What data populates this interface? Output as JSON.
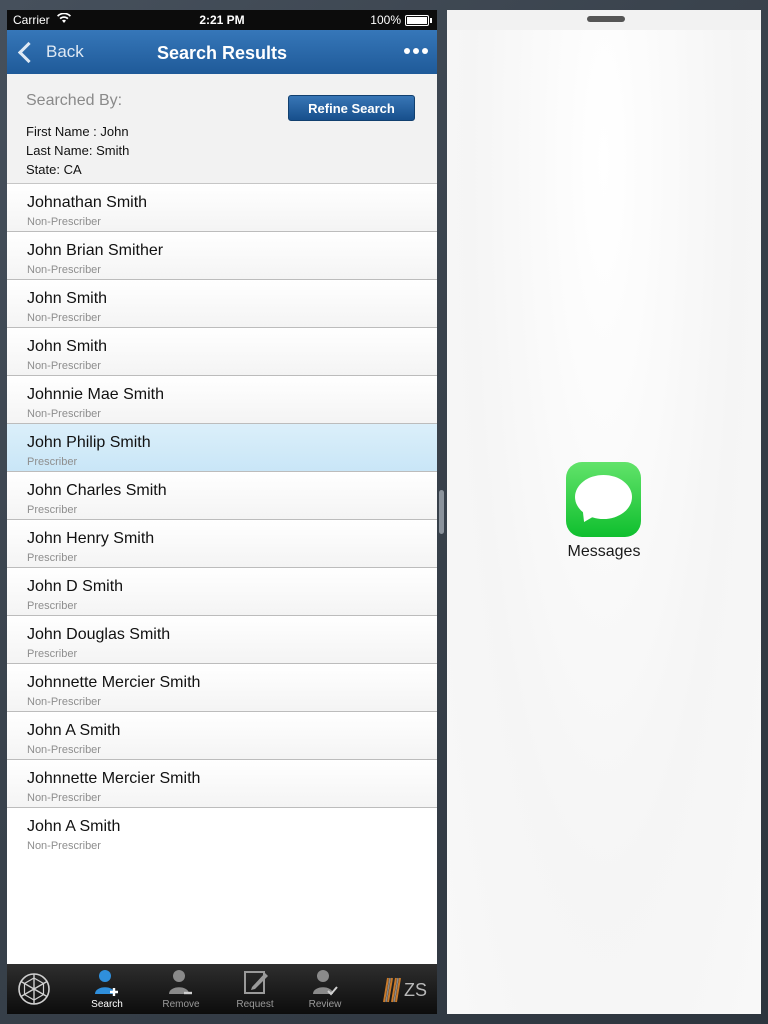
{
  "status_bar": {
    "carrier": "Carrier",
    "time": "2:21 PM",
    "battery": "100%"
  },
  "nav": {
    "back_label": "Back",
    "title": "Search Results"
  },
  "search_summary": {
    "heading": "Searched By:",
    "lines": [
      "First Name : John",
      "Last Name: Smith",
      "State: CA"
    ],
    "refine_label": "Refine Search"
  },
  "results": [
    {
      "name": "Johnathan Smith",
      "role": "Non-Prescriber"
    },
    {
      "name": "John Brian Smither",
      "role": "Non-Prescriber"
    },
    {
      "name": "John Smith",
      "role": "Non-Prescriber"
    },
    {
      "name": "John Smith",
      "role": "Non-Prescriber"
    },
    {
      "name": "Johnnie Mae Smith",
      "role": "Non-Prescriber"
    },
    {
      "name": "John Philip Smith",
      "role": "Prescriber"
    },
    {
      "name": "John Charles Smith",
      "role": "Prescriber"
    },
    {
      "name": "John Henry Smith",
      "role": "Prescriber"
    },
    {
      "name": "John D Smith",
      "role": "Prescriber"
    },
    {
      "name": "John Douglas Smith",
      "role": "Prescriber"
    },
    {
      "name": "Johnnette Mercier Smith",
      "role": "Non-Prescriber"
    },
    {
      "name": "John A Smith",
      "role": "Non-Prescriber"
    },
    {
      "name": "Johnnette Mercier Smith",
      "role": "Non-Prescriber"
    },
    {
      "name": "John A Smith",
      "role": "Non-Prescriber"
    }
  ],
  "tabs": [
    {
      "label": "Search",
      "icon": "search-person-icon"
    },
    {
      "label": "Remove",
      "icon": "remove-person-icon"
    },
    {
      "label": "Request",
      "icon": "request-edit-icon"
    },
    {
      "label": "Review",
      "icon": "review-person-icon"
    }
  ],
  "brand": {
    "zs_text": "ZS"
  },
  "right_app": {
    "label": "Messages",
    "icon": "messages-app-icon"
  },
  "colors": {
    "nav_blue": "#2a69aa",
    "selected_row": "#d3ebf9",
    "tab_active": "#2f8fdc",
    "messages_green": "#2dd14a"
  }
}
